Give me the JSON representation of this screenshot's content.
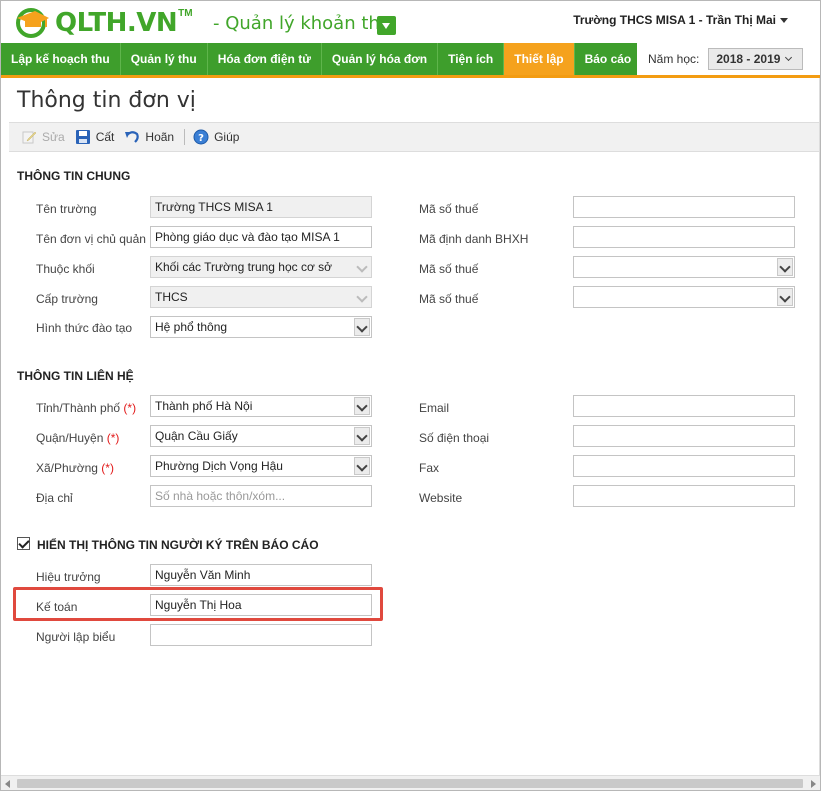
{
  "header": {
    "logo_text": "QLTH.VN",
    "logo_tm": "TM",
    "app_name": "- Quản lý khoản thu",
    "user": "Trường THCS MISA 1 - Trần Thị Mai"
  },
  "nav": {
    "items": [
      "Lập kế hoạch thu",
      "Quản lý thu",
      "Hóa đơn điện tử",
      "Quản lý hóa đơn",
      "Tiện ích",
      "Thiết lập",
      "Báo cáo"
    ],
    "active": "Thiết lập",
    "year_label": "Năm học:",
    "year_value": "2018 - 2019"
  },
  "page": {
    "title": "Thông tin đơn vị"
  },
  "toolbar": {
    "edit": "Sửa",
    "save": "Cất",
    "undo": "Hoãn",
    "help": "Giúp"
  },
  "general": {
    "title": "THÔNG TIN CHUNG",
    "school_name_label": "Tên trường",
    "school_name": "Trường THCS MISA 1",
    "parent_unit_label": "Tên đơn vị chủ quản",
    "parent_unit": "Phòng giáo dục và đào tạo MISA 1",
    "block_label": "Thuộc khối",
    "block": "Khối các Trường trung học cơ sở",
    "level_label": "Cấp trường",
    "level": "THCS",
    "training_label": "Hình thức đào tạo",
    "training": "Hệ phổ thông",
    "tax_code_label": "Mã số thuế",
    "tax_code": "",
    "bhxh_label": "Mã định danh BHXH",
    "bhxh": "",
    "tax_code2_label": "Mã số thuế",
    "tax_code2": "",
    "tax_code3_label": "Mã số thuế",
    "tax_code3": ""
  },
  "contact": {
    "title": "THÔNG TIN LIÊN HỆ",
    "province_label": "Tỉnh/Thành phố",
    "province": "Thành phố Hà Nội",
    "district_label": "Quận/Huyện",
    "district": "Quận Cầu Giấy",
    "ward_label": "Xã/Phường",
    "ward": "Phường Dịch Vọng Hậu",
    "address_label": "Địa chỉ",
    "address_placeholder": "Số nhà hoặc thôn/xóm...",
    "email_label": "Email",
    "phone_label": "Số điện thoại",
    "fax_label": "Fax",
    "website_label": "Website",
    "required_mark": "(*)"
  },
  "signers": {
    "title": "HIỂN THỊ THÔNG TIN NGƯỜI KÝ TRÊN BÁO CÁO",
    "checked": true,
    "principal_label": "Hiệu trưởng",
    "principal": "Nguyễn Văn Minh",
    "accountant_label": "Kế toán",
    "accountant": "Nguyễn Thị Hoa",
    "preparer_label": "Người lập biểu",
    "preparer": ""
  },
  "colors": {
    "brand_green": "#41a62a",
    "nav_active": "#f5a21d",
    "highlight": "#e0493e",
    "required": "#e21a1a"
  }
}
